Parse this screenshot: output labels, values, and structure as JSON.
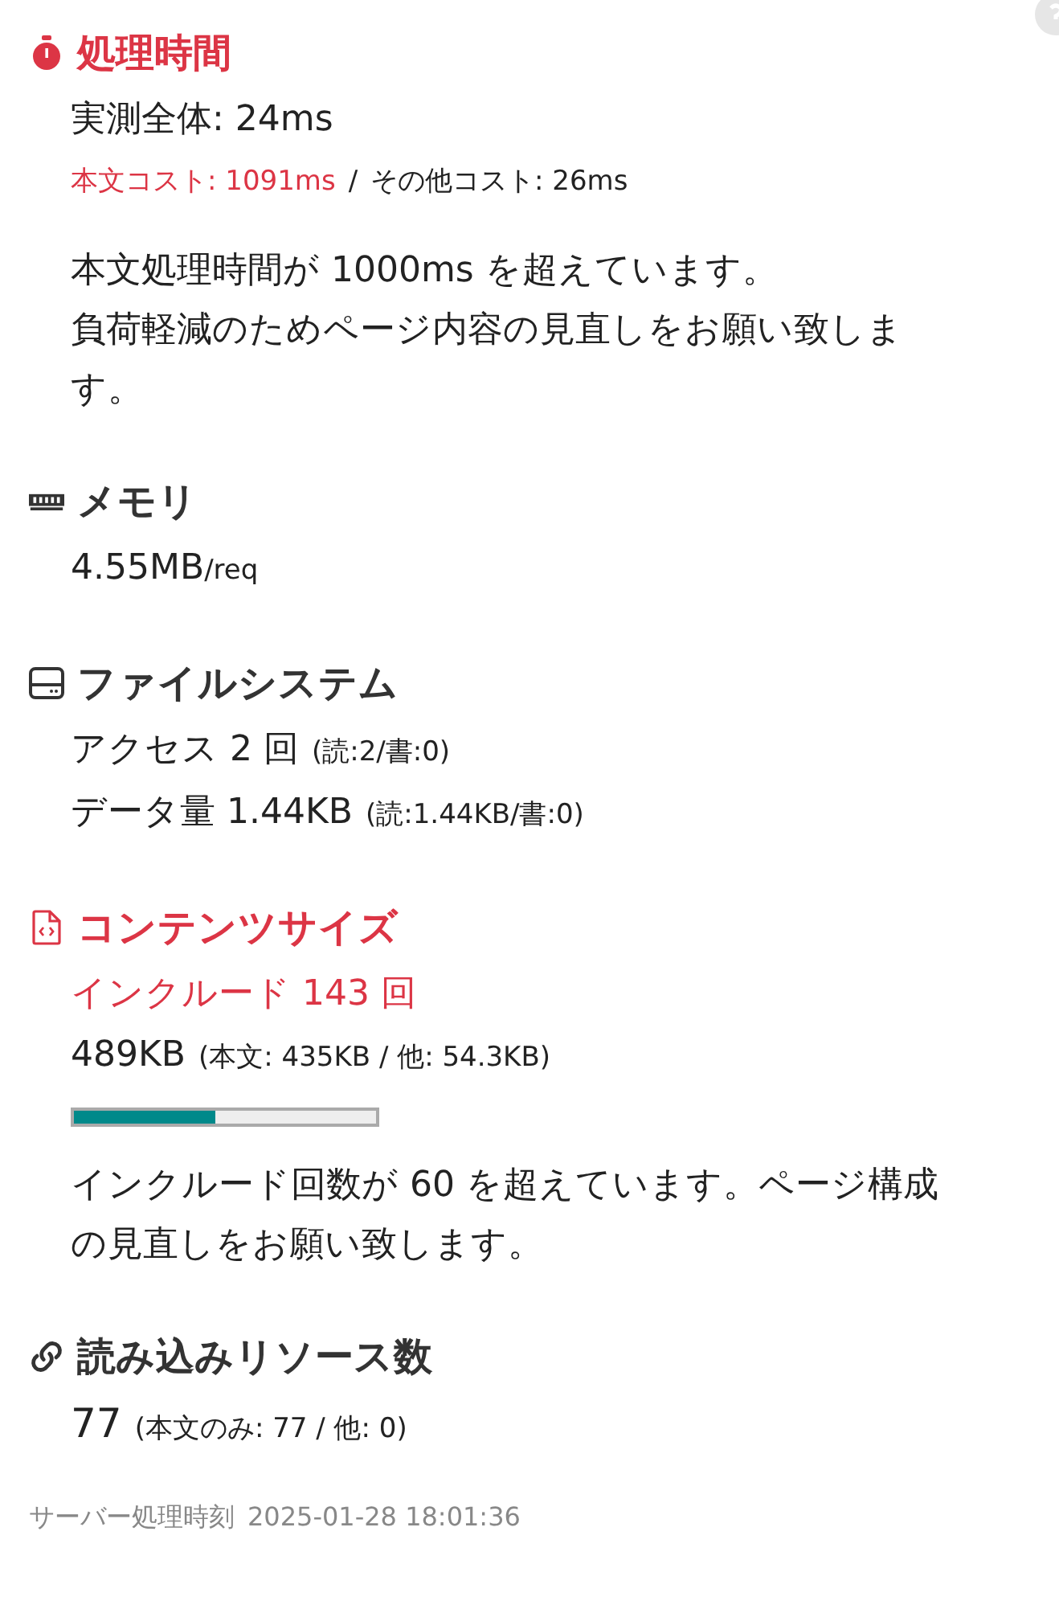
{
  "sections": [
    {
      "kind": "stopwatch",
      "alert": true,
      "title": "処理時間",
      "rows": [
        {
          "segments": [
            {
              "kind": "main",
              "text": "実測全体: 24ms",
              "alert": false
            }
          ]
        },
        {
          "segments": [
            {
              "kind": "detail",
              "text": "本文コスト: 1091ms",
              "alert": true
            },
            {
              "kind": "detail",
              "text": "/",
              "alert": false
            },
            {
              "kind": "detail",
              "text": "その他コスト: 26ms",
              "alert": false
            }
          ]
        }
      ],
      "note": [
        "本文処理時間が 1000ms を超えています。",
        "負荷軽減のためページ内容の見直しをお願い致します。"
      ]
    },
    {
      "kind": "memory",
      "alert": false,
      "title": "メモリ",
      "rows": [
        {
          "segments": [
            {
              "kind": "main",
              "text": "4.55MB",
              "alert": false
            },
            {
              "kind": "unit",
              "text": "/req",
              "alert": false
            }
          ]
        }
      ]
    },
    {
      "kind": "drive",
      "alert": false,
      "title": "ファイルシステム",
      "rows": [
        {
          "segments": [
            {
              "kind": "main",
              "text": "アクセス 2 回",
              "alert": false
            },
            {
              "kind": "detail",
              "text": "(読:2/書:0)",
              "alert": false
            }
          ]
        },
        {
          "segments": [
            {
              "kind": "main",
              "text": "データ量 1.44KB",
              "alert": false
            },
            {
              "kind": "detail",
              "text": "(読:1.44KB/書:0)",
              "alert": false
            }
          ]
        }
      ]
    },
    {
      "kind": "code-file",
      "alert": true,
      "title": "コンテンツサイズ",
      "rows": [
        {
          "segments": [
            {
              "kind": "main",
              "text": "インクルード 143 回",
              "alert": true
            }
          ]
        },
        {
          "segments": [
            {
              "kind": "main",
              "text": "489KB",
              "alert": false
            },
            {
              "kind": "detail",
              "text": "(本文: 435KB / 他: 54.3KB)",
              "alert": false
            }
          ]
        }
      ],
      "level": 0.47,
      "note": [
        "インクルード回数が 60 を超えています。ページ構成の見直しをお願い致します。"
      ]
    },
    {
      "kind": "link",
      "alert": false,
      "title": "読み込みリソース数",
      "rows": [
        {
          "segments": [
            {
              "kind": "big",
              "text": "77",
              "alert": false
            },
            {
              "kind": "detail",
              "text": "(本文のみ: 77 / 他: 0)",
              "alert": false
            }
          ]
        }
      ]
    }
  ],
  "footer": {
    "label": "サーバー処理時刻",
    "time": "2025-01-28 18:01:36"
  }
}
